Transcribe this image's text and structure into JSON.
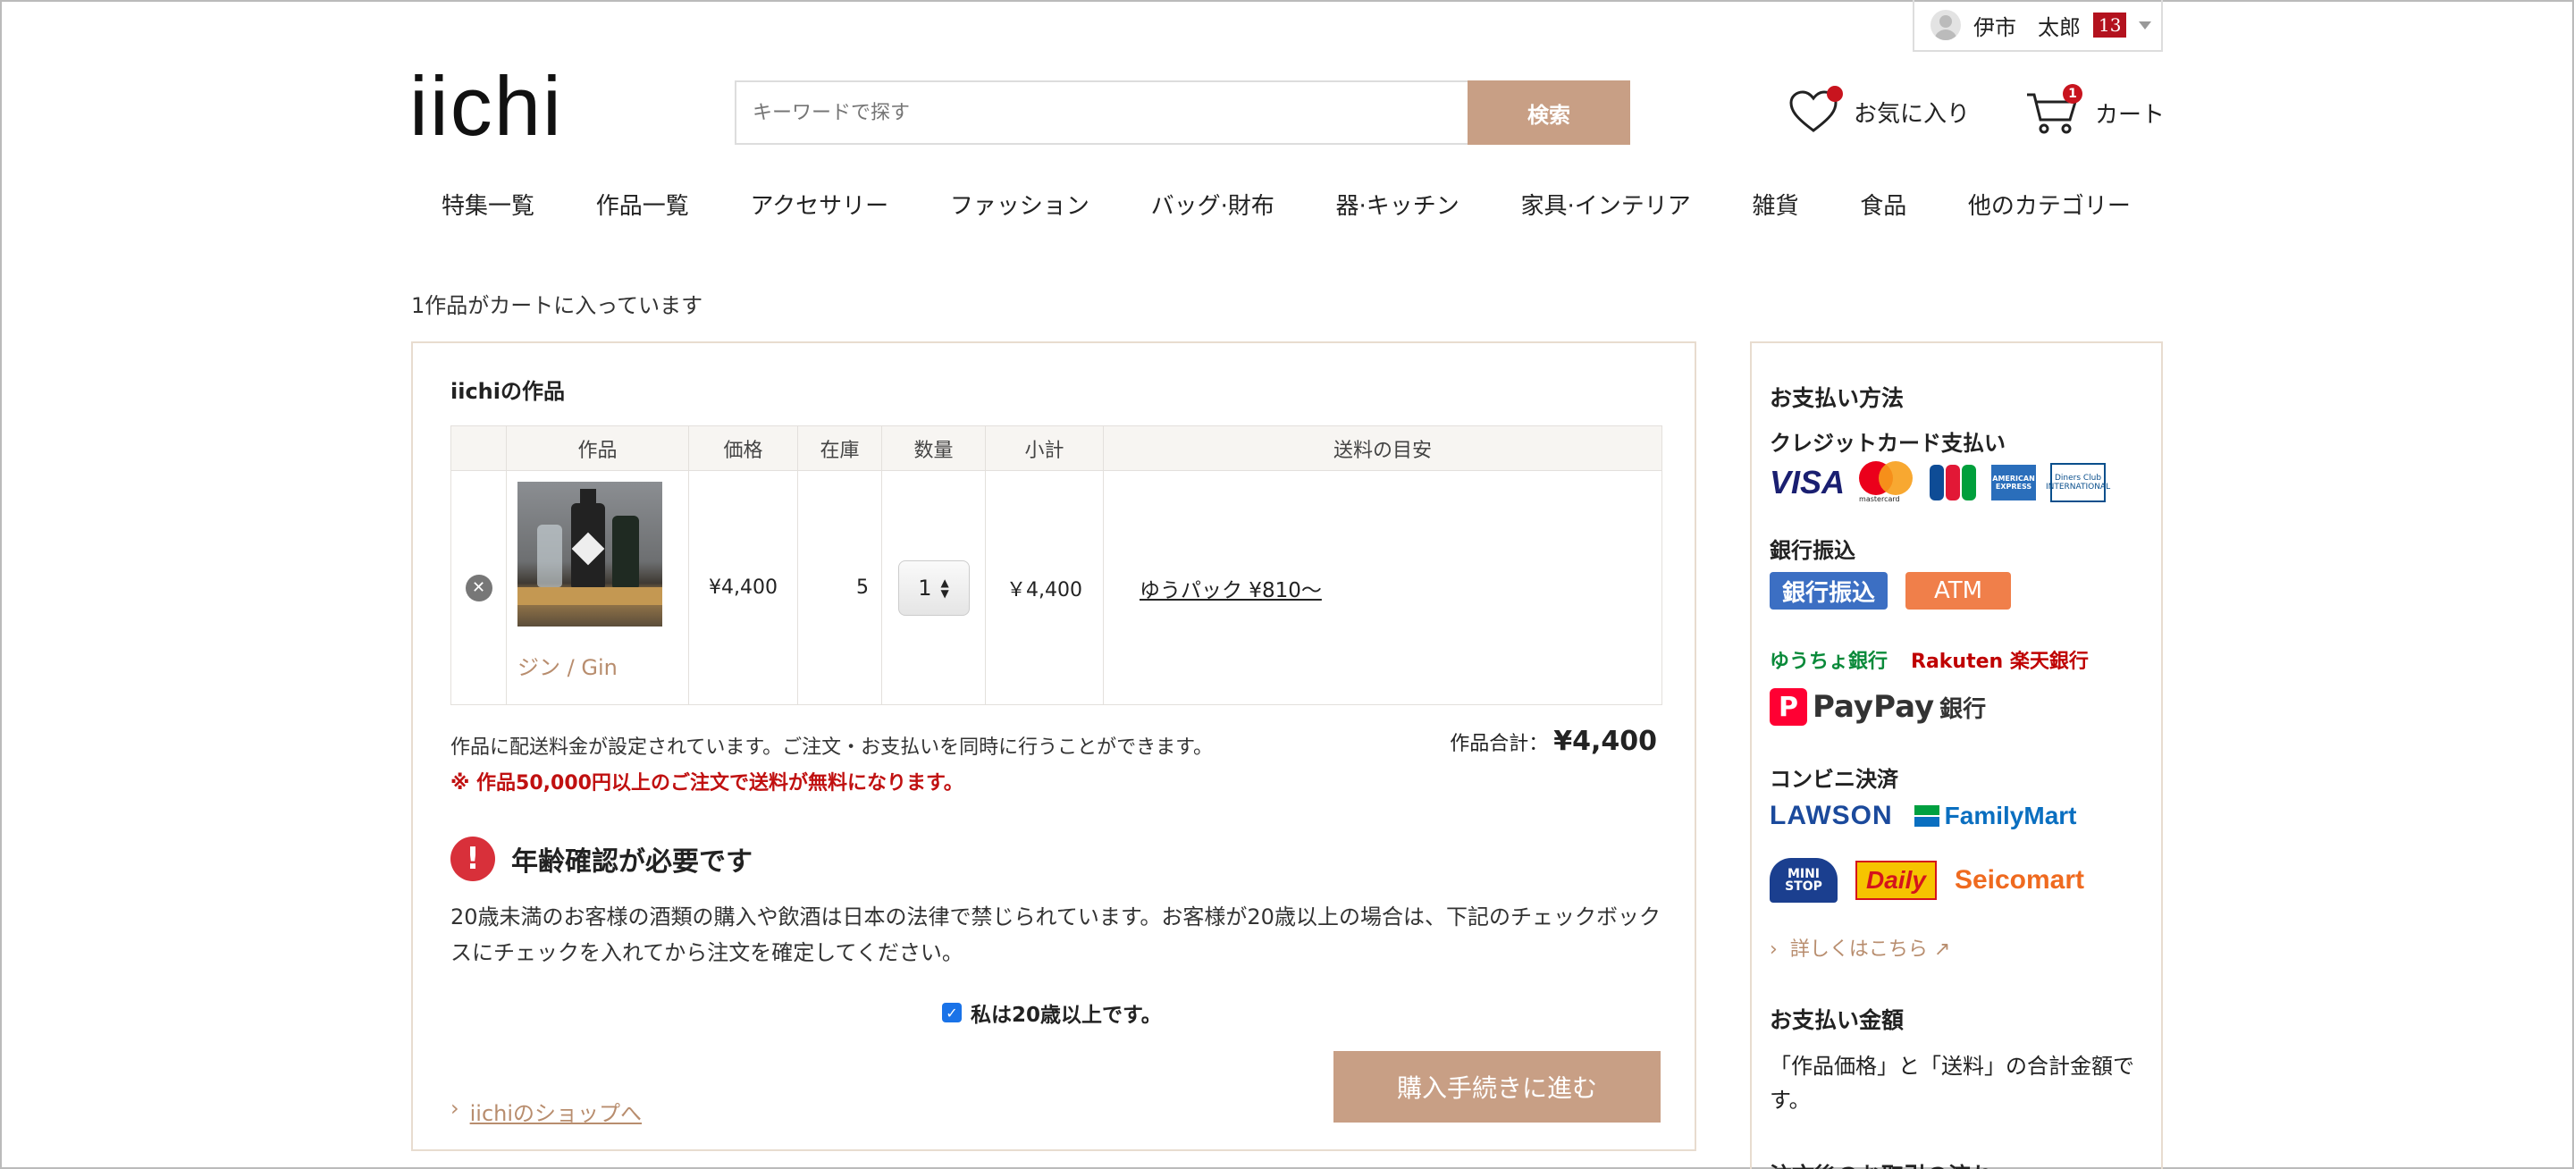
{
  "user_menu": {
    "name": "伊市　太郎",
    "count": "13"
  },
  "header": {
    "logo": "iichi",
    "search_placeholder": "キーワードで探す",
    "search_button": "検索",
    "favorites_label": "お気に入り",
    "cart_label": "カート",
    "cart_count": "1"
  },
  "nav": [
    "特集一覧",
    "作品一覧",
    "アクセサリー",
    "ファッション",
    "バッグ·財布",
    "器·キッチン",
    "家具·インテリア",
    "雑貨",
    "食品",
    "他のカテゴリー"
  ],
  "cart_summary": "1作品がカートに入っています",
  "section_title": "iichiの作品",
  "table": {
    "headers": [
      "作品",
      "価格",
      "在庫",
      "数量",
      "小計",
      "送料の目安"
    ],
    "rows": [
      {
        "name": "ジン / Gin",
        "price": "¥4,400",
        "stock": "5",
        "qty": "1",
        "subtotal": "￥4,400",
        "shipping": "ゆうパック ¥810〜"
      }
    ]
  },
  "notice": "作品に配送料金が設定されています。ご注文・お支払いを同時に行うことができます。",
  "free_shipping": "※ 作品50,000円以上のご注文で送料が無料になります。",
  "total_label": "作品合計：",
  "total_value": "¥4,400",
  "age": {
    "title": "年齢確認が必要です",
    "text": "20歳未満のお客様の酒類の購入や飲酒は日本の法律で禁じられています。お客様が20歳以上の場合は、下記のチェックボックスにチェックを入れてから注文を確定してください。",
    "confirm": "私は20歳以上です。"
  },
  "proceed_button": "購入手続きに進む",
  "shop_link": "iichiのショップへ",
  "sidebar": {
    "payment_title": "お支払い方法",
    "credit_title": "クレジットカード支払い",
    "card_logos": [
      "VISA",
      "mastercard",
      "JCB",
      "AMERICAN EXPRESS",
      "Diners Club INTERNATIONAL"
    ],
    "bank_title": "銀行振込",
    "bank_chip": "銀行振込",
    "atm_chip": "ATM",
    "yucho": "ゆうちょ銀行",
    "rakuten": "Rakuten 楽天銀行",
    "paypay": "PayPay",
    "paypay_bank": "銀行",
    "convenience_title": "コンビニ決済",
    "lawson": "LAWSON",
    "familymart": "FamilyMart",
    "ministop": "MINI STOP",
    "daily": "Daily",
    "seicomart": "Seicomart",
    "more_link": "詳しくはこちら",
    "amount_title": "お支払い金額",
    "amount_text": "「作品価格」と「送料」の合計金額です。",
    "next_title": "注文後のお取引の流れ"
  },
  "colors": {
    "accent": "#c89f85",
    "alert": "#c01010",
    "border": "#e8dccf"
  }
}
